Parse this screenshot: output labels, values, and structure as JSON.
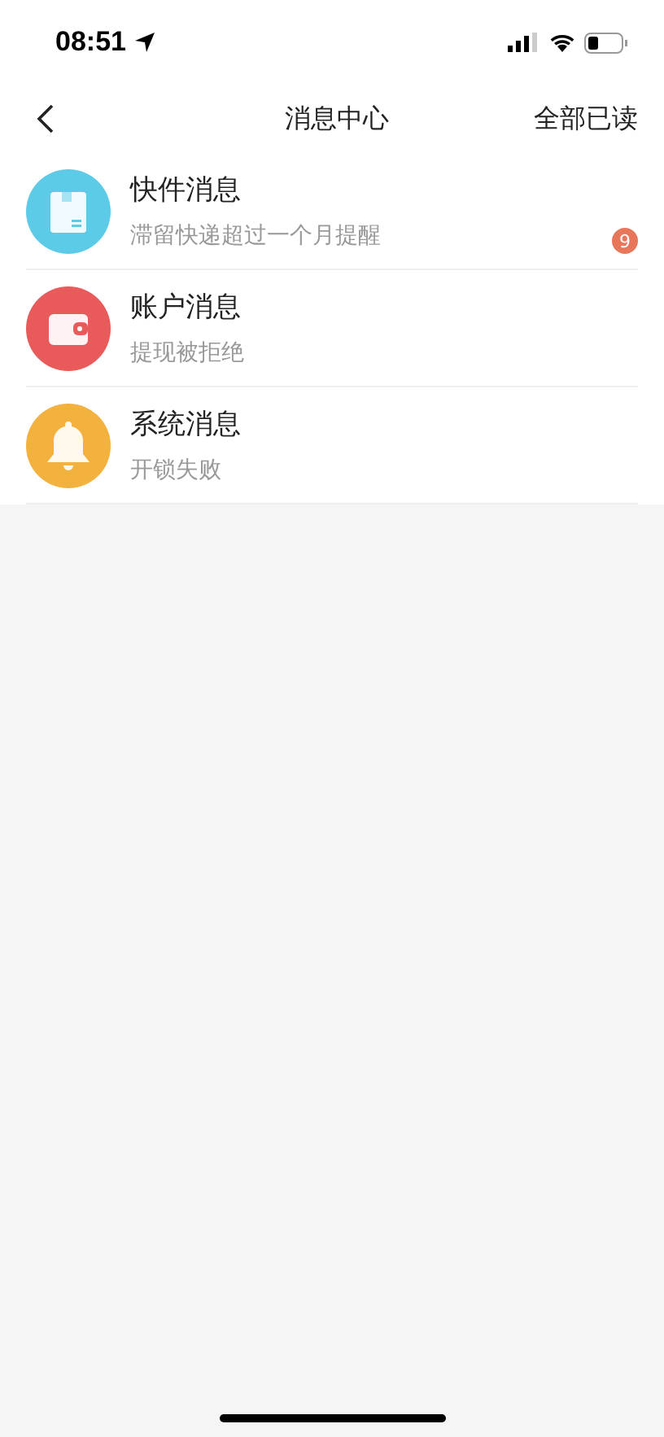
{
  "status_bar": {
    "time": "08:51"
  },
  "nav": {
    "title": "消息中心",
    "action": "全部已读"
  },
  "messages": [
    {
      "kind": "package",
      "color": "#5ccbe8",
      "title": "快件消息",
      "preview": "滞留快递超过一个月提醒",
      "badge": "9"
    },
    {
      "kind": "wallet",
      "color": "#e95a5a",
      "title": "账户消息",
      "preview": "提现被拒绝"
    },
    {
      "kind": "bell",
      "color": "#f3b23e",
      "title": "系统消息",
      "preview": "开锁失败"
    }
  ]
}
